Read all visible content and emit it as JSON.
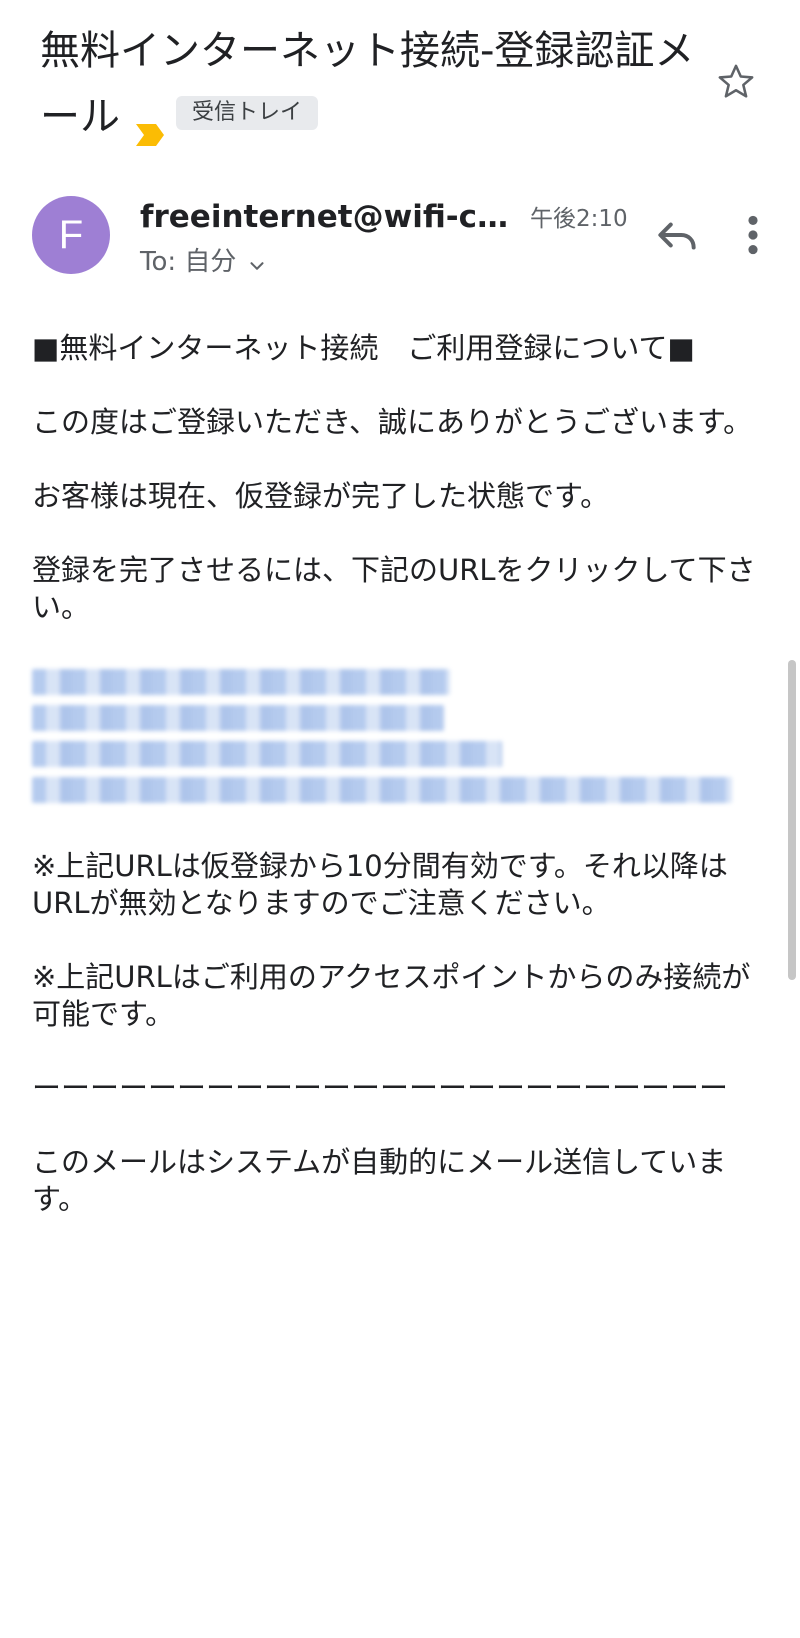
{
  "email": {
    "subject": "無料インターネット接続-登録認証メール",
    "label": "受信トレイ",
    "sender": {
      "initial": "F",
      "name": "freeinternet@wifi-clo...",
      "time": "午後2:10",
      "recipient": "To: 自分"
    },
    "body": {
      "heading": "■無料インターネット接続　ご利用登録について■",
      "p1": "この度はご登録いただき、誠にありがとうございます。",
      "p2": "お客様は現在、仮登録が完了した状態です。",
      "p3": "登録を完了させるには、下記のURLをクリックして下さい。",
      "note1": "※上記URLは仮登録から10分間有効です。それ以降はURLが無効となりますのでご注意ください。",
      "note2": "※上記URLはご利用のアクセスポイントからのみ接続が可能です。",
      "divider": "ーーーーーーーーーーーーーーーーーーーーーーーー",
      "footer": "このメールはシステムが自動的にメール送信しています。"
    }
  },
  "icons": {
    "star": "star-outline-icon",
    "important": "important-marker-icon",
    "reply": "reply-icon",
    "more": "more-vert-icon",
    "chevron": "chevron-down-icon"
  },
  "colors": {
    "avatar": "#9e7fd4",
    "important": "#fbbc04",
    "link_redacted": "#7aa0e1"
  }
}
